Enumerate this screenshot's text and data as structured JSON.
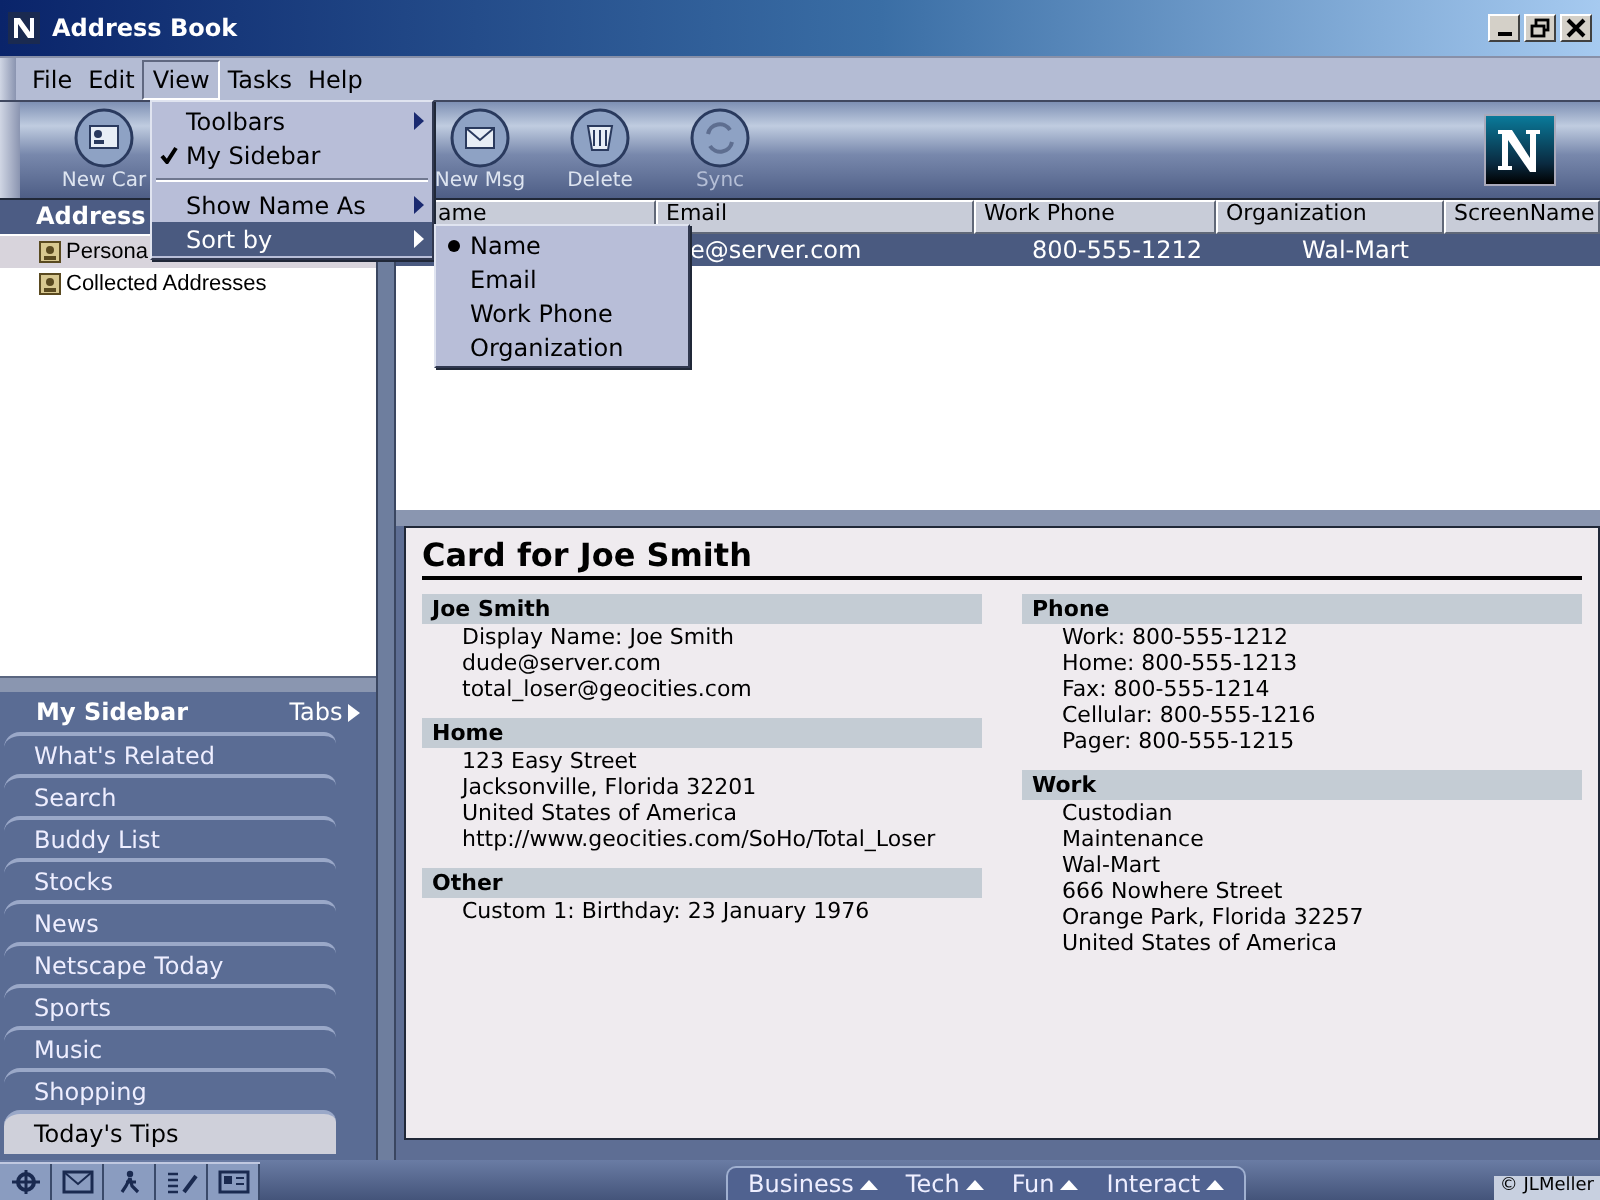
{
  "window": {
    "title": "Address Book"
  },
  "menu_bar": [
    {
      "label": "File",
      "selected": false
    },
    {
      "label": "Edit",
      "selected": false
    },
    {
      "label": "View",
      "selected": true
    },
    {
      "label": "Tasks",
      "selected": false
    },
    {
      "label": "Help",
      "selected": false
    }
  ],
  "view_menu": [
    {
      "kind": "submenu",
      "label": "Toolbars",
      "checked": false,
      "selected": false
    },
    {
      "kind": "check",
      "label": "My Sidebar",
      "checked": true,
      "selected": false
    },
    {
      "kind": "separator"
    },
    {
      "kind": "submenu",
      "label": "Show Name As",
      "checked": false,
      "selected": false
    },
    {
      "kind": "submenu",
      "label": "Sort by",
      "checked": false,
      "selected": true
    }
  ],
  "sort_submenu": [
    {
      "label": "Name",
      "selected": true
    },
    {
      "label": "Email",
      "selected": false
    },
    {
      "label": "Work Phone",
      "selected": false
    },
    {
      "label": "Organization",
      "selected": false
    }
  ],
  "toolbar": {
    "buttons": [
      {
        "kind": "card",
        "label": "New Car",
        "disabled": false
      },
      {
        "kind": "message",
        "label": "New Msg",
        "disabled": false
      },
      {
        "kind": "delete",
        "label": "Delete",
        "disabled": false
      },
      {
        "kind": "sync",
        "label": "Sync",
        "disabled": true
      }
    ]
  },
  "address_panel": {
    "heading": "Address",
    "items": [
      {
        "label": "Persona",
        "selected": true
      },
      {
        "label": "Collected Addresses",
        "selected": false
      }
    ]
  },
  "table": {
    "columns": [
      "ame",
      "Email",
      "Work Phone",
      "Organization",
      "ScreenName"
    ],
    "rows": [
      {
        "email": "e@server.com",
        "work_phone": "800-555-1212",
        "organization": "Wal-Mart",
        "selected": true
      }
    ]
  },
  "card": {
    "title": "Card for Joe Smith",
    "left": [
      {
        "heading": "Joe Smith",
        "lines": [
          "Display Name: Joe Smith",
          "dude@server.com",
          "total_loser@geocities.com"
        ]
      },
      {
        "heading": "Home",
        "lines": [
          "123 Easy Street",
          "Jacksonville, Florida 32201",
          "United States of America",
          "http://www.geocities.com/SoHo/Total_Loser"
        ]
      },
      {
        "heading": "Other",
        "lines": [
          "Custom 1: Birthday: 23 January 1976"
        ]
      }
    ],
    "right": [
      {
        "heading": "Phone",
        "lines": [
          "Work: 800-555-1212",
          "Home: 800-555-1213",
          "Fax: 800-555-1214",
          "Cellular: 800-555-1216",
          "Pager: 800-555-1215"
        ]
      },
      {
        "heading": "Work",
        "lines": [
          "Custodian",
          "Maintenance",
          "Wal-Mart",
          "666 Nowhere Street",
          "Orange Park, Florida 32257",
          "United States of America"
        ]
      }
    ]
  },
  "sidebar": {
    "title": "My Sidebar",
    "tabs_button": "Tabs",
    "items": [
      {
        "label": "What's Related",
        "selected": false
      },
      {
        "label": "Search",
        "selected": false
      },
      {
        "label": "Buddy List",
        "selected": false
      },
      {
        "label": "Stocks",
        "selected": false
      },
      {
        "label": "News",
        "selected": false
      },
      {
        "label": "Netscape Today",
        "selected": false
      },
      {
        "label": "Sports",
        "selected": false
      },
      {
        "label": "Music",
        "selected": false
      },
      {
        "label": "Shopping",
        "selected": false
      },
      {
        "label": "Today's Tips",
        "selected": true
      }
    ]
  },
  "bottom_bar": {
    "tabs": [
      "Business",
      "Tech",
      "Fun",
      "Interact"
    ],
    "copyright": "© JLMeller"
  }
}
